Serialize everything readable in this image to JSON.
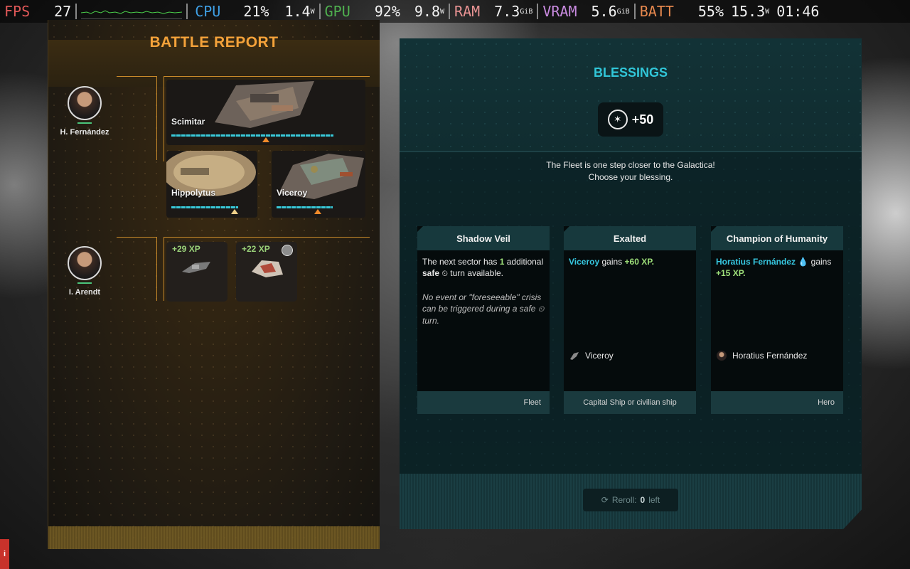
{
  "osd": {
    "fps_label": "FPS",
    "fps_value": "27",
    "cpu_label": "CPU",
    "cpu_pct": "21%",
    "cpu_watts": "1.4",
    "cpu_watts_unit": "W",
    "gpu_label": "GPU",
    "gpu_pct": "92%",
    "gpu_watts": "9.8",
    "gpu_watts_unit": "W",
    "ram_label": "RAM",
    "ram_value": "7.3",
    "ram_unit": "GiB",
    "vram_label": "VRAM",
    "vram_value": "5.6",
    "vram_unit": "GiB",
    "batt_label": "BATT",
    "batt_pct": "55%",
    "batt_watts": "15.3",
    "batt_watts_unit": "W",
    "clock": "01:46"
  },
  "battle_report": {
    "title": "BATTLE REPORT",
    "heroes": [
      {
        "name": "H. Fernández",
        "ships": [
          {
            "name": "Scimitar",
            "health": 0.86,
            "marker": 0.5
          },
          {
            "name": "Hippolytus",
            "health": 0.8,
            "marker": 0.75
          },
          {
            "name": "Viceroy",
            "health": 0.68,
            "marker": 0.5
          }
        ]
      },
      {
        "name": "I. Arendt",
        "xp_rewards": [
          {
            "label": "+29 XP"
          },
          {
            "label": "+22 XP"
          }
        ]
      }
    ]
  },
  "blessings": {
    "title": "BLESSINGS",
    "reward_value": "+50",
    "message_line1": "The Fleet is one step closer to the Galactica!",
    "message_line2": "Choose your blessing.",
    "cards": [
      {
        "title": "Shadow Veil",
        "text_a": "The next sector has ",
        "text_count": "1",
        "text_b": " additional ",
        "text_safe": "safe",
        "text_c": " turn available.",
        "note_a": "No event or \"foreseeable\" crisis can be triggered during a ",
        "note_safe": "safe",
        "note_b": " turn.",
        "footer": "Fleet"
      },
      {
        "title": "Exalted",
        "target_name": "Viceroy",
        "text_gains": " gains ",
        "text_xp": "+60 XP.",
        "selected": "Viceroy",
        "footer": "Capital Ship or civilian ship"
      },
      {
        "title": "Champion of Humanity",
        "target_name": "Horatius Fernández",
        "text_gains": " gains",
        "text_xp": "+15 XP.",
        "selected": "Horatius Fernández",
        "footer": "Hero"
      }
    ],
    "reroll_label": "Reroll: ",
    "reroll_count": "0",
    "reroll_suffix": " left"
  },
  "colors": {
    "accent_orange": "#f4a23a",
    "accent_cyan": "#31c6d8",
    "xp_green": "#9ee07a"
  },
  "icons": [
    "cylon-icon",
    "clock-icon",
    "reroll-icon",
    "info-icon",
    "ship-icon",
    "hero-portrait-icon"
  ]
}
